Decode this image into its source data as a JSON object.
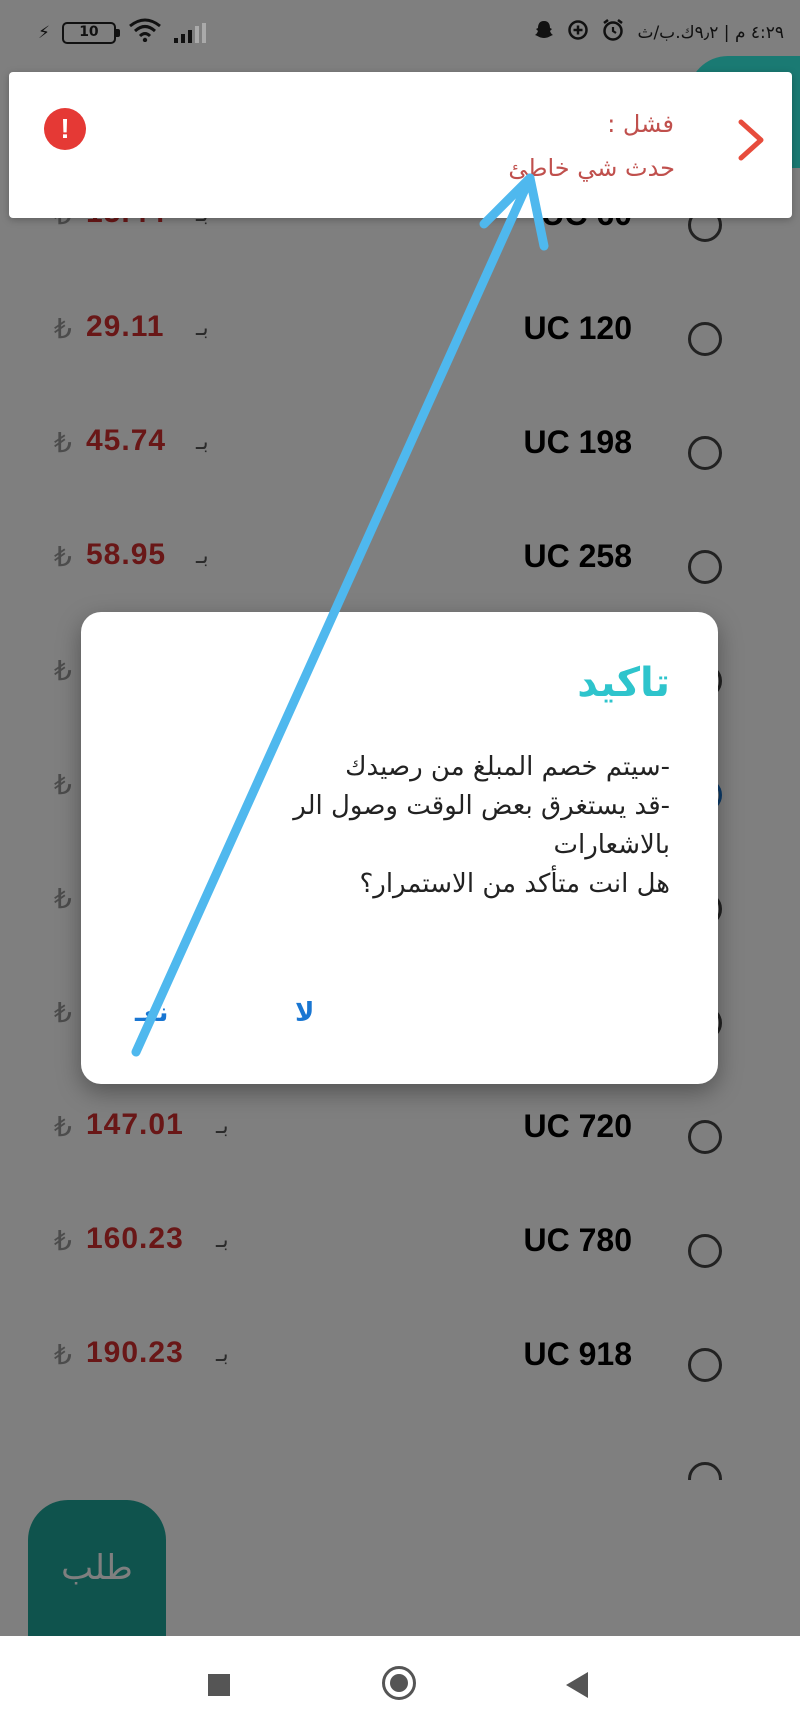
{
  "status_bar": {
    "time": "٤:٢٩ م | ٩٫٢ك.ب/ث",
    "battery": "10"
  },
  "packages": [
    {
      "label": "UC 60",
      "price": "15.44",
      "by": "بـ",
      "currency": "₺"
    },
    {
      "label": "UC 120",
      "price": "29.11",
      "by": "بـ",
      "currency": "₺"
    },
    {
      "label": "UC 198",
      "price": "45.74",
      "by": "بـ",
      "currency": "₺"
    },
    {
      "label": "UC 258",
      "price": "58.95",
      "by": "بـ",
      "currency": "₺"
    },
    {
      "label": "",
      "price": "",
      "by": "",
      "currency": "₺"
    },
    {
      "label": "",
      "price": "",
      "by": "",
      "currency": "₺"
    },
    {
      "label": "",
      "price": "",
      "by": "",
      "currency": "₺"
    },
    {
      "label": "",
      "price": "",
      "by": "",
      "currency": "₺"
    },
    {
      "label": "UC 720",
      "price": "147.01",
      "by": "بـ",
      "currency": "₺"
    },
    {
      "label": "UC 780",
      "price": "160.23",
      "by": "بـ",
      "currency": "₺"
    },
    {
      "label": "UC 918",
      "price": "190.23",
      "by": "بـ",
      "currency": "₺"
    }
  ],
  "toast": {
    "title": "فشل :",
    "message": "حدث شي خاطئ",
    "icon": "!"
  },
  "dialog": {
    "title": "تاكيد",
    "body": "-سيتم خصم المبلغ من رصيدك\n-قد يستغرق بعض الوقت وصول الر\nبالاشعارات\nهل انت متأكد من الاستمرار؟",
    "no_label": "لا",
    "yes_label": "نعـ"
  },
  "order_button": {
    "label": "طلب"
  },
  "colors": {
    "accent": "#2ec4cc",
    "order": "#1fa79a",
    "price": "#d32f2f",
    "error": "#e53935"
  }
}
